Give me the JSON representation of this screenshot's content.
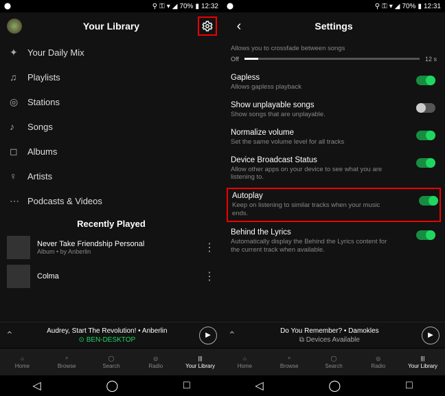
{
  "left": {
    "status": {
      "time": "12:32",
      "battery": "70%"
    },
    "header": {
      "title": "Your Library"
    },
    "menu": [
      {
        "icon": "✦",
        "label": "Your Daily Mix"
      },
      {
        "icon": "♫",
        "label": "Playlists"
      },
      {
        "icon": "◎",
        "label": "Stations"
      },
      {
        "icon": "♪",
        "label": "Songs"
      },
      {
        "icon": "◻",
        "label": "Albums"
      },
      {
        "icon": "♀",
        "label": "Artists"
      },
      {
        "icon": "⋯",
        "label": "Podcasts & Videos"
      }
    ],
    "recently_heading": "Recently Played",
    "recent": [
      {
        "title": "Never Take Friendship Personal",
        "sub": "Album • by Anberlin"
      },
      {
        "title": "Colma",
        "sub": ""
      }
    ],
    "now": {
      "line1": "Audrey, Start The Revolution! • Anberlin",
      "line2": "⊙ BEN-DESKTOP"
    }
  },
  "right": {
    "status": {
      "time": "12:31",
      "battery": "70%"
    },
    "header": {
      "title": "Settings"
    },
    "crossfade": {
      "desc": "Allows you to crossfade between songs",
      "left": "Off",
      "right": "12 s"
    },
    "items": [
      {
        "label": "Gapless",
        "desc": "Allows gapless playback",
        "on": true
      },
      {
        "label": "Show unplayable songs",
        "desc": "Show songs that are unplayable.",
        "on": false
      },
      {
        "label": "Normalize volume",
        "desc": "Set the same volume level for all tracks",
        "on": true
      },
      {
        "label": "Device Broadcast Status",
        "desc": "Allow other apps on your device to see what you are listening to.",
        "on": true
      },
      {
        "label": "Autoplay",
        "desc": "Keep on listening to similar tracks when your music ends.",
        "on": true,
        "hi": true
      },
      {
        "label": "Behind the Lyrics",
        "desc": "Automatically display the Behind the Lyrics content for the current track when available.",
        "on": true
      }
    ],
    "now": {
      "line1": "Do You Remember? • Damokles",
      "line2": "⧉ Devices Available"
    }
  },
  "tabs": [
    {
      "icon": "⌂",
      "label": "Home"
    },
    {
      "icon": "⌕",
      "label": "Browse"
    },
    {
      "icon": "◯",
      "label": "Search"
    },
    {
      "icon": "◎",
      "label": "Radio"
    },
    {
      "icon": "|||",
      "label": "Your Library",
      "active": true
    }
  ]
}
